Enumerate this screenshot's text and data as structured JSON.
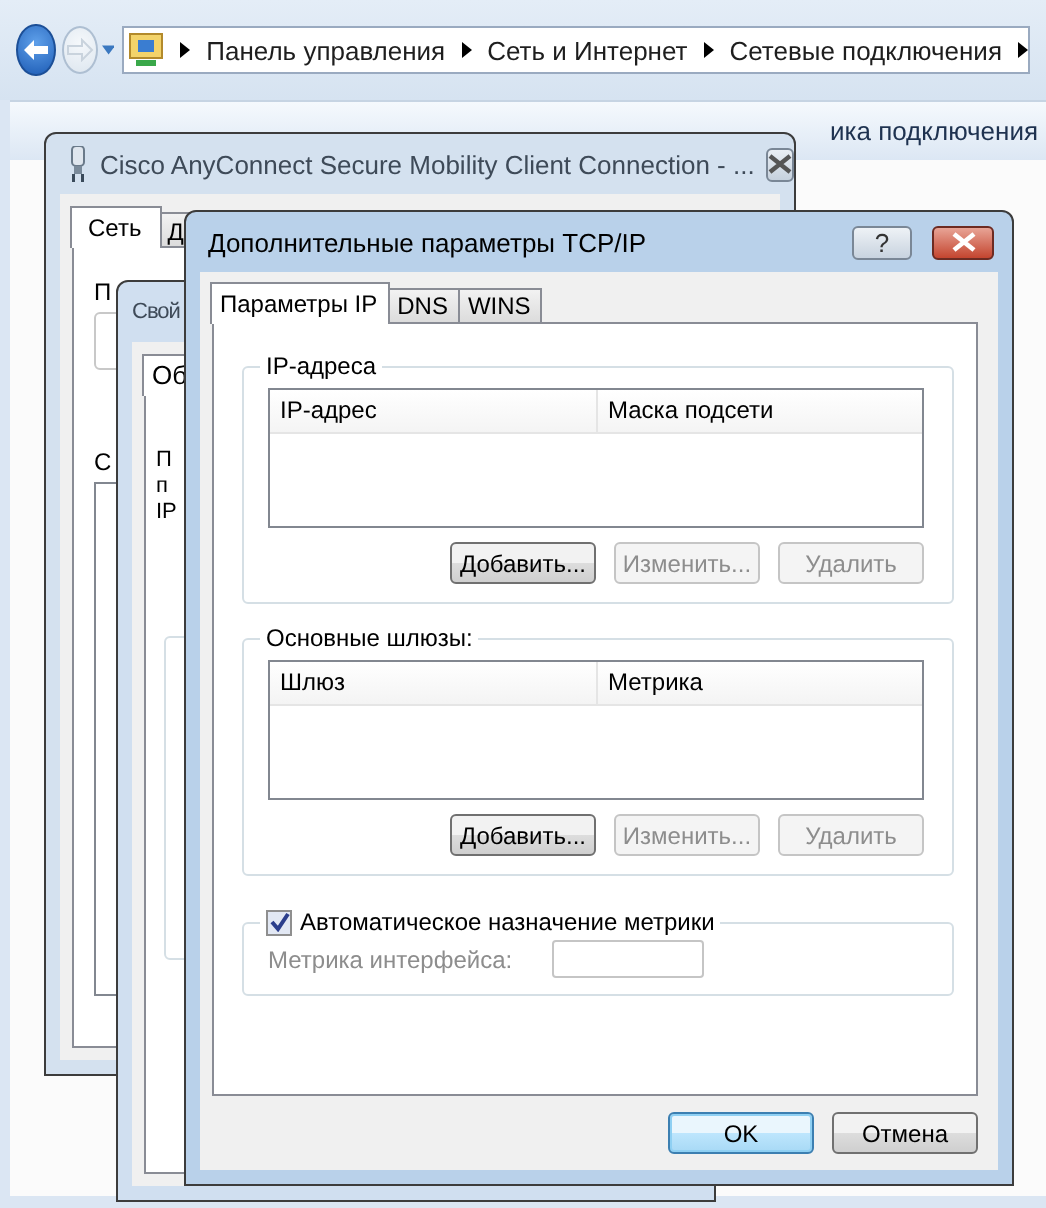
{
  "explorer": {
    "breadcrumb": [
      "Панель управления",
      "Сеть и Интернет",
      "Сетевые подключения"
    ],
    "toolbar_text": "ика подключения"
  },
  "cisco_dialog": {
    "title": "Cisco AnyConnect Secure Mobility Client Connection - ...",
    "tabs": [
      {
        "label": "Сеть",
        "selected": true
      },
      {
        "label": "Д",
        "selected": false
      }
    ],
    "labels": [
      "П",
      "С"
    ]
  },
  "properties_dialog": {
    "title": "Свой",
    "tabs": [
      {
        "label": "Об",
        "selected": true
      }
    ],
    "text_lines": [
      "П",
      "п",
      "IP"
    ]
  },
  "tcpip_dialog": {
    "title": "Дополнительные параметры TCP/IP",
    "help": "?",
    "tabs": [
      {
        "label": "Параметры IP",
        "selected": true
      },
      {
        "label": "DNS",
        "selected": false
      },
      {
        "label": "WINS",
        "selected": false
      }
    ],
    "groups": [
      {
        "kind": "list",
        "title": "IP-адреса",
        "columns": [
          "IP-адрес",
          "Маска подсети"
        ],
        "buttons": [
          {
            "label": "Добавить...",
            "disabled": false
          },
          {
            "label": "Изменить...",
            "disabled": true
          },
          {
            "label": "Удалить",
            "disabled": true
          }
        ]
      },
      {
        "kind": "list",
        "title": "Основные шлюзы:",
        "columns": [
          "Шлюз",
          "Метрика"
        ],
        "buttons": [
          {
            "label": "Добавить...",
            "disabled": false
          },
          {
            "label": "Изменить...",
            "disabled": true
          },
          {
            "label": "Удалить",
            "disabled": true
          }
        ]
      },
      {
        "kind": "metric",
        "title": "Автоматическое назначение метрики",
        "checked": true,
        "field_label": "Метрика интерфейса:",
        "disabled": true
      }
    ],
    "buttons": [
      {
        "label": "OK",
        "default": true
      },
      {
        "label": "Отмена",
        "default": false
      }
    ]
  }
}
